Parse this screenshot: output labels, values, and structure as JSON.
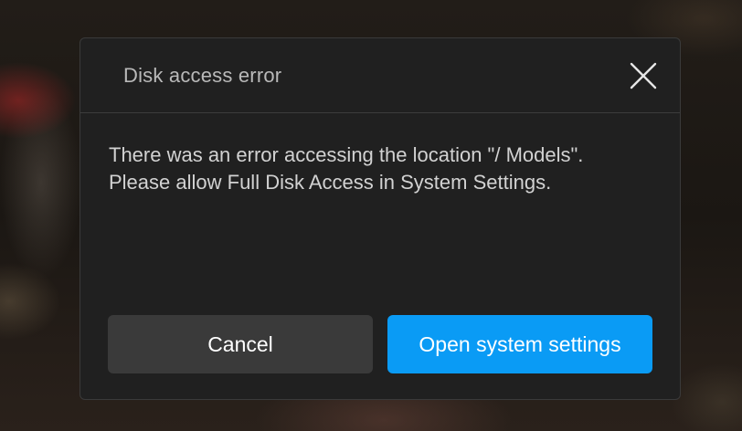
{
  "dialog": {
    "title": "Disk access error",
    "close_icon": "close-icon",
    "message": "There was an error accessing the location \"/ Models\". Please allow Full Disk Access in System Settings.",
    "buttons": {
      "cancel_label": "Cancel",
      "primary_label": "Open system settings"
    }
  },
  "colors": {
    "primary_button": "#0a9bf5",
    "secondary_button": "#3a3a3a",
    "dialog_background": "#202020"
  }
}
